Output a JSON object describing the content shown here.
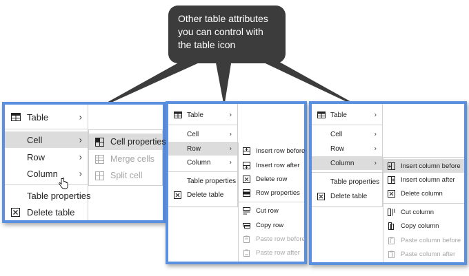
{
  "callout": {
    "line1": "Other table attributes",
    "line2": "you can control with",
    "line3": "the table icon"
  },
  "panel1": {
    "main": [
      {
        "label": "Table",
        "icon": "table-icon",
        "chevron": true
      },
      {
        "label": "Cell",
        "chevron": true,
        "highlighted": true
      },
      {
        "label": "Row",
        "chevron": true
      },
      {
        "label": "Column",
        "chevron": true
      },
      {
        "label": "Table properties"
      },
      {
        "label": "Delete table",
        "icon": "delete-table-icon"
      }
    ],
    "sub": [
      {
        "label": "Cell properties",
        "icon": "cell-properties-icon",
        "highlighted": true
      },
      {
        "label": "Merge cells",
        "icon": "merge-cells-icon",
        "disabled": true
      },
      {
        "label": "Split cell",
        "icon": "split-cell-icon",
        "disabled": true
      }
    ]
  },
  "panel2": {
    "main": [
      {
        "label": "Table",
        "icon": "table-icon",
        "chevron": true
      },
      {
        "label": "Cell",
        "chevron": true
      },
      {
        "label": "Row",
        "chevron": true,
        "highlighted": true
      },
      {
        "label": "Column",
        "chevron": true
      },
      {
        "label": "Table properties"
      },
      {
        "label": "Delete table",
        "icon": "delete-table-icon"
      }
    ],
    "sub": [
      {
        "label": "Insert row before",
        "icon": "insert-row-before-icon"
      },
      {
        "label": "Insert row after",
        "icon": "insert-row-after-icon"
      },
      {
        "label": "Delete row",
        "icon": "delete-row-icon"
      },
      {
        "label": "Row properties",
        "icon": "row-properties-icon"
      },
      {
        "label": "Cut row",
        "icon": "cut-row-icon"
      },
      {
        "label": "Copy row",
        "icon": "copy-row-icon"
      },
      {
        "label": "Paste row before",
        "icon": "paste-row-before-icon",
        "disabled": true
      },
      {
        "label": "Paste row after",
        "icon": "paste-row-after-icon",
        "disabled": true
      }
    ]
  },
  "panel3": {
    "main": [
      {
        "label": "Table",
        "icon": "table-icon",
        "chevron": true
      },
      {
        "label": "Cell",
        "chevron": true
      },
      {
        "label": "Row",
        "chevron": true
      },
      {
        "label": "Column",
        "chevron": true,
        "highlighted": true
      },
      {
        "label": "Table properties"
      },
      {
        "label": "Delete table",
        "icon": "delete-table-icon"
      }
    ],
    "sub": [
      {
        "label": "Insert column before",
        "icon": "insert-column-before-icon",
        "highlighted": true
      },
      {
        "label": "Insert column after",
        "icon": "insert-column-after-icon"
      },
      {
        "label": "Delete column",
        "icon": "delete-column-icon"
      },
      {
        "label": "Cut column",
        "icon": "cut-column-icon"
      },
      {
        "label": "Copy column",
        "icon": "copy-column-icon"
      },
      {
        "label": "Paste column before",
        "icon": "paste-column-before-icon",
        "disabled": true
      },
      {
        "label": "Paste column after",
        "icon": "paste-column-after-icon",
        "disabled": true
      }
    ]
  },
  "cursor": {
    "icon": "hand-pointer-icon"
  }
}
